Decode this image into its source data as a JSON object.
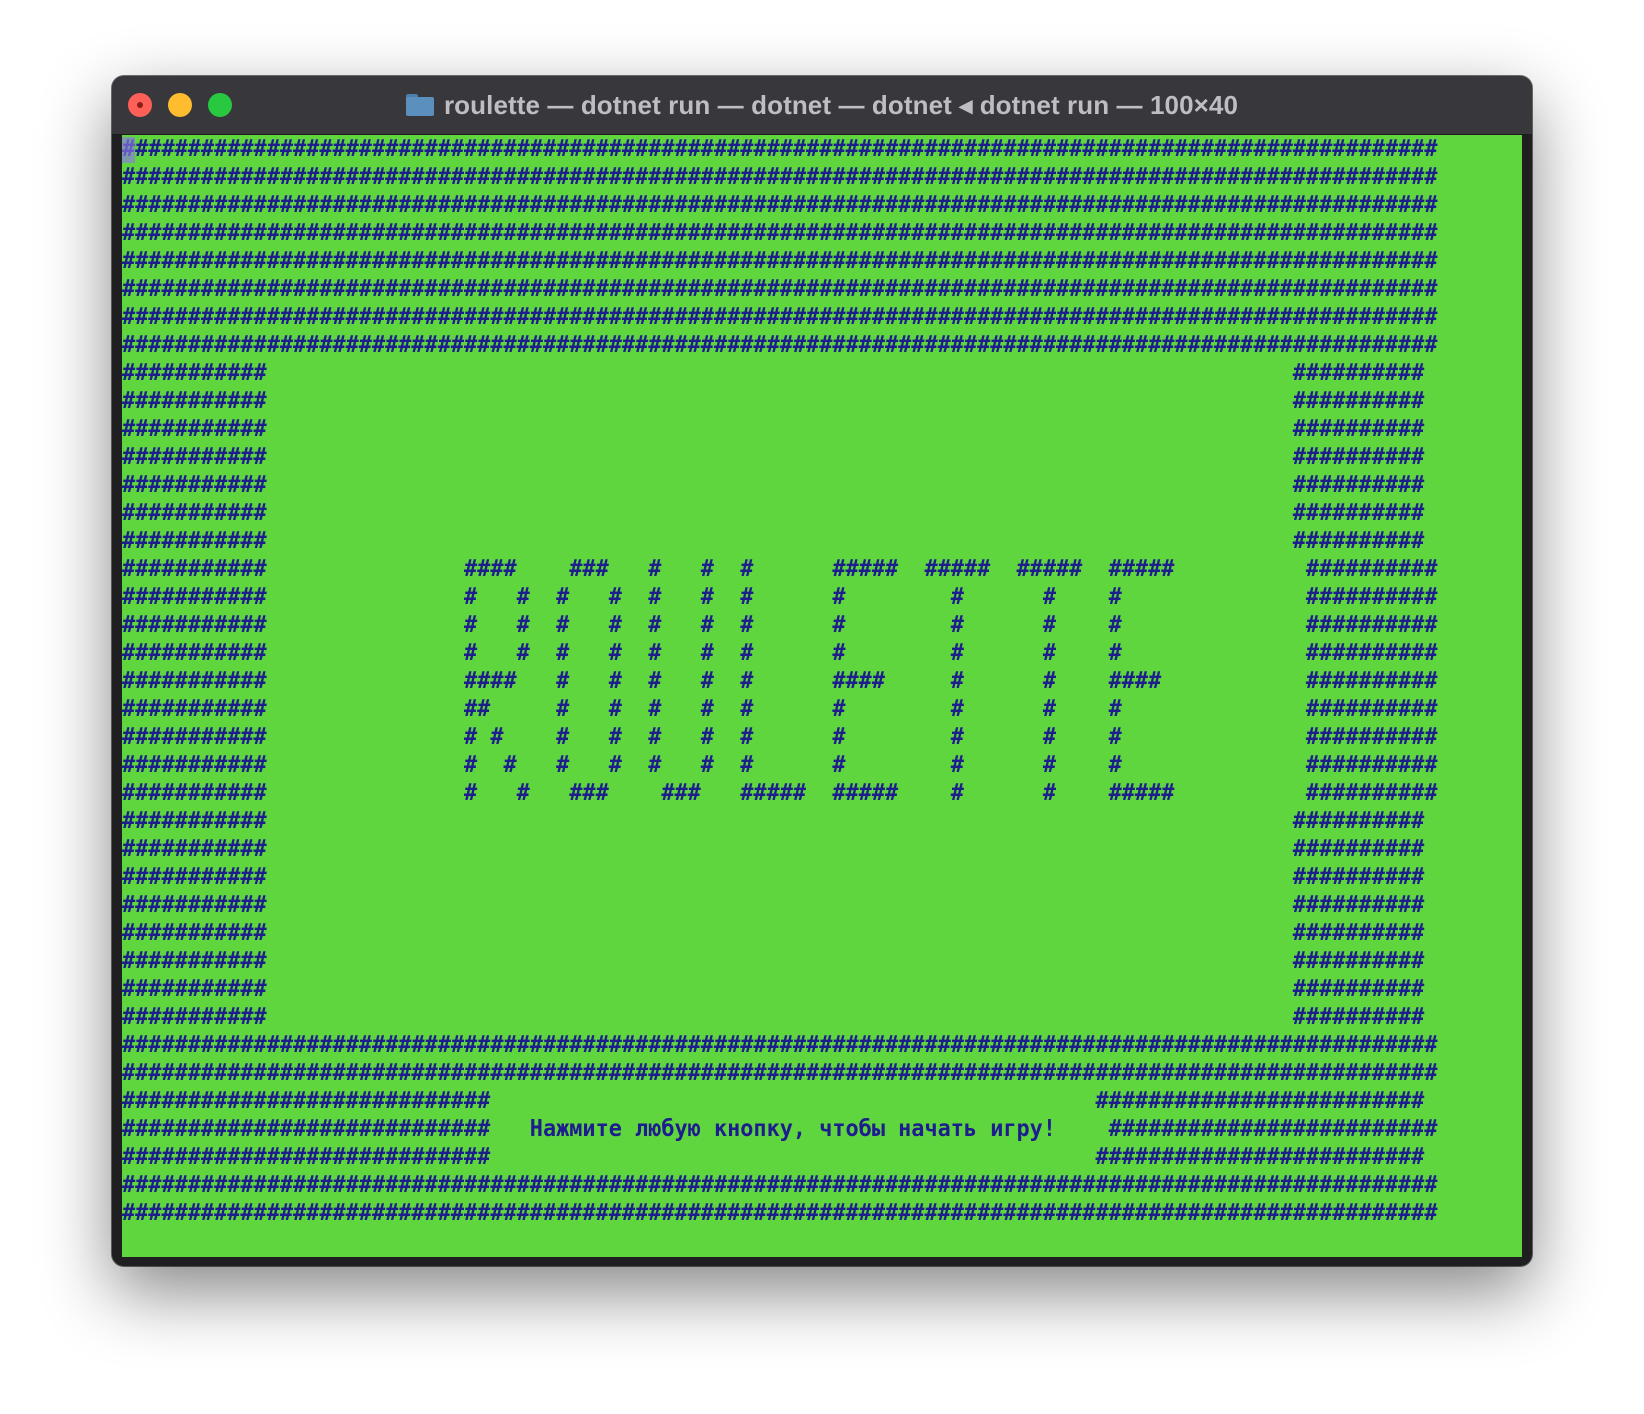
{
  "window": {
    "title": "roulette — dotnet run — dotnet — dotnet ◂ dotnet run — 100×40",
    "icon": "folder-icon"
  },
  "terminal": {
    "background": "#5fd53e",
    "foreground": "#1d1d8d",
    "lines": [
      "####################################################################################################",
      "####################################################################################################",
      "####################################################################################################",
      "####################################################################################################",
      "####################################################################################################",
      "####################################################################################################",
      "####################################################################################################",
      "####################################################################################################",
      "###########                                                                              ##########",
      "###########                                                                              ##########",
      "###########                                                                              ##########",
      "###########                                                                              ##########",
      "###########                                                                              ##########",
      "###########                                                                              ##########",
      "###########                                                                              ##########",
      "###########               ####    ###   #   #  #      #####  #####  #####  #####          ##########",
      "###########               #   #  #   #  #   #  #      #        #      #    #              ##########",
      "###########               #   #  #   #  #   #  #      #        #      #    #              ##########",
      "###########               #   #  #   #  #   #  #      #        #      #    #              ##########",
      "###########               ####   #   #  #   #  #      ####     #      #    ####           ##########",
      "###########               ##     #   #  #   #  #      #        #      #    #              ##########",
      "###########               # #    #   #  #   #  #      #        #      #    #              ##########",
      "###########               #  #   #   #  #   #  #      #        #      #    #              ##########",
      "###########               #   #   ###    ###   #####  #####    #      #    #####          ##########",
      "###########                                                                              ##########",
      "###########                                                                              ##########",
      "###########                                                                              ##########",
      "###########                                                                              ##########",
      "###########                                                                              ##########",
      "###########                                                                              ##########",
      "###########                                                                              ##########",
      "###########                                                                              ##########",
      "####################################################################################################",
      "####################################################################################################",
      "############################                                              #########################",
      "############################   Нажмите любую кнопку, чтобы начать игру!    #########################",
      "############################                                              #########################",
      "####################################################################################################",
      "####################################################################################################",
      ""
    ]
  }
}
